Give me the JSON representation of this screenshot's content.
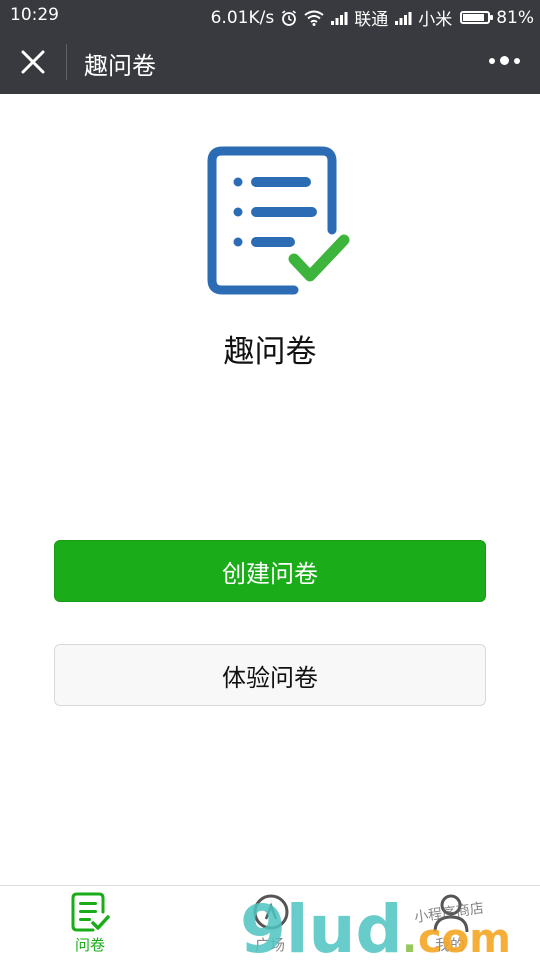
{
  "status_bar": {
    "time": "10:29",
    "speed": "6.01K/s",
    "carrier1": "联通",
    "carrier2": "小米",
    "battery": "81%",
    "battery_level": 0.81
  },
  "nav": {
    "title": "趣问卷"
  },
  "app": {
    "name": "趣问卷"
  },
  "buttons": {
    "create_label": "创建问卷",
    "try_label": "体验问卷"
  },
  "tabs": [
    {
      "label": "问卷",
      "active": true
    },
    {
      "label": "广场",
      "active": false
    },
    {
      "label": "我的",
      "active": false
    }
  ],
  "watermark": {
    "text": "9lud.com",
    "subtext": "小程序商店"
  },
  "colors": {
    "nav_bg": "#393a3f",
    "accent_green": "#1aad19",
    "logo_blue": "#2b6cb5",
    "check_green": "#3db53c",
    "watermark_teal": "#4ec5c1",
    "watermark_green": "#8bc34a",
    "watermark_orange": "#f5a623"
  }
}
